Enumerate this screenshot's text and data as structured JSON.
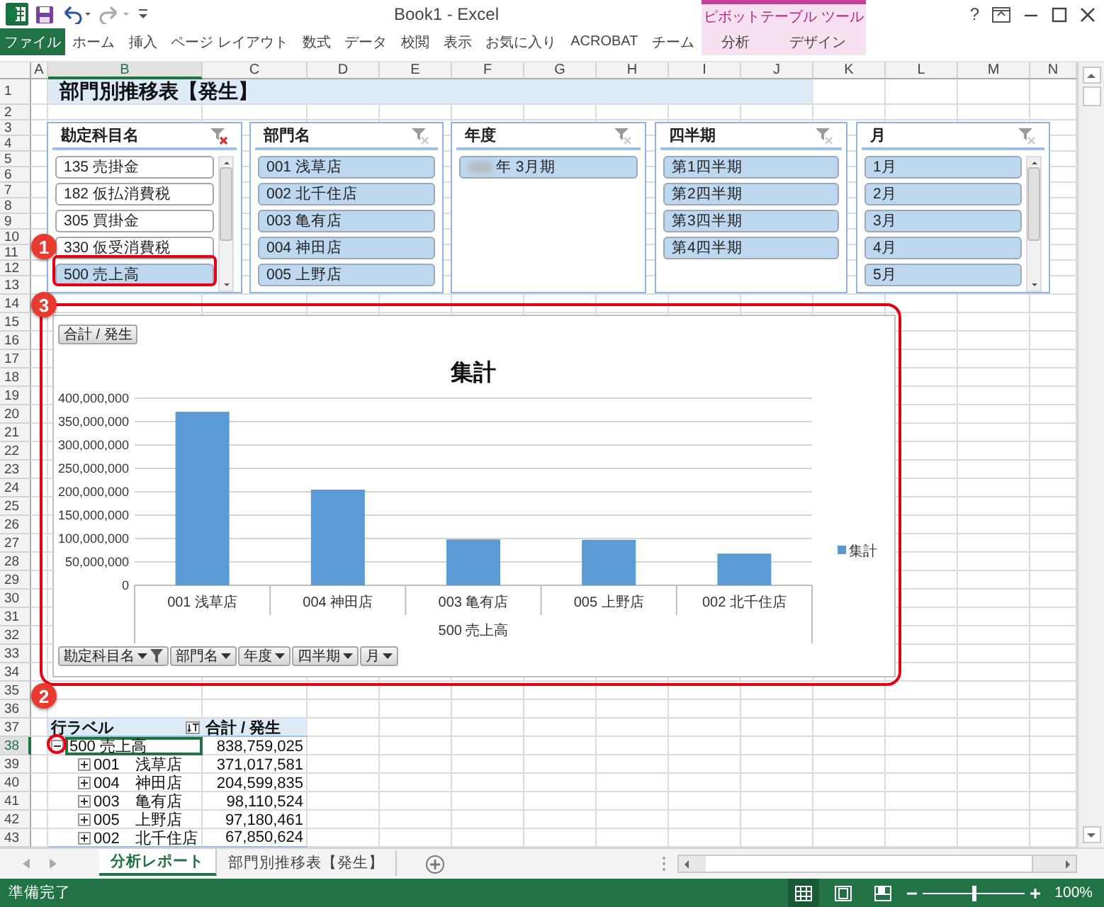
{
  "window": {
    "title": "Book1 - Excel",
    "context_label": "ピボットテーブル ツール",
    "help": "?"
  },
  "ribbon_tabs": [
    {
      "label": "ファイル",
      "kind": "file",
      "selected": false
    },
    {
      "label": "ホーム",
      "kind": "normal",
      "selected": false
    },
    {
      "label": "挿入",
      "kind": "normal",
      "selected": false
    },
    {
      "label": "ページ レイアウト",
      "kind": "normal",
      "selected": false
    },
    {
      "label": "数式",
      "kind": "normal",
      "selected": false
    },
    {
      "label": "データ",
      "kind": "normal",
      "selected": false
    },
    {
      "label": "校閲",
      "kind": "normal",
      "selected": false
    },
    {
      "label": "表示",
      "kind": "normal",
      "selected": false
    },
    {
      "label": "お気に入り",
      "kind": "normal",
      "selected": false
    },
    {
      "label": "ACROBAT",
      "kind": "normal",
      "selected": false
    },
    {
      "label": "チーム",
      "kind": "normal",
      "selected": false
    },
    {
      "label": "分析",
      "kind": "context",
      "selected": false
    },
    {
      "label": "デザイン",
      "kind": "context",
      "selected": false
    }
  ],
  "columns": [
    {
      "label": "A",
      "selected": false
    },
    {
      "label": "B",
      "selected": true
    },
    {
      "label": "C",
      "selected": false
    },
    {
      "label": "D",
      "selected": false
    },
    {
      "label": "E",
      "selected": false
    },
    {
      "label": "F",
      "selected": false
    },
    {
      "label": "G",
      "selected": false
    },
    {
      "label": "H",
      "selected": false
    },
    {
      "label": "I",
      "selected": false
    },
    {
      "label": "J",
      "selected": false
    },
    {
      "label": "K",
      "selected": false
    },
    {
      "label": "L",
      "selected": false
    },
    {
      "label": "M",
      "selected": false
    },
    {
      "label": "N",
      "selected": false
    }
  ],
  "rows": [
    {
      "label": "1",
      "selected": false
    },
    {
      "label": "2",
      "selected": false
    },
    {
      "label": "3",
      "selected": false
    },
    {
      "label": "4",
      "selected": false
    },
    {
      "label": "5",
      "selected": false
    },
    {
      "label": "6",
      "selected": false
    },
    {
      "label": "7",
      "selected": false
    },
    {
      "label": "8",
      "selected": false
    },
    {
      "label": "9",
      "selected": false
    },
    {
      "label": "10",
      "selected": false
    },
    {
      "label": "11",
      "selected": false
    },
    {
      "label": "12",
      "selected": false
    },
    {
      "label": "13",
      "selected": false
    },
    {
      "label": "14",
      "selected": false
    },
    {
      "label": "15",
      "selected": false
    },
    {
      "label": "16",
      "selected": false
    },
    {
      "label": "17",
      "selected": false
    },
    {
      "label": "18",
      "selected": false
    },
    {
      "label": "19",
      "selected": false
    },
    {
      "label": "20",
      "selected": false
    },
    {
      "label": "21",
      "selected": false
    },
    {
      "label": "22",
      "selected": false
    },
    {
      "label": "23",
      "selected": false
    },
    {
      "label": "24",
      "selected": false
    },
    {
      "label": "25",
      "selected": false
    },
    {
      "label": "26",
      "selected": false
    },
    {
      "label": "27",
      "selected": false
    },
    {
      "label": "28",
      "selected": false
    },
    {
      "label": "29",
      "selected": false
    },
    {
      "label": "30",
      "selected": false
    },
    {
      "label": "31",
      "selected": false
    },
    {
      "label": "32",
      "selected": false
    },
    {
      "label": "33",
      "selected": false
    },
    {
      "label": "34",
      "selected": false
    },
    {
      "label": "35",
      "selected": false
    },
    {
      "label": "36",
      "selected": false
    },
    {
      "label": "37",
      "selected": false
    },
    {
      "label": "38",
      "selected": true
    },
    {
      "label": "39",
      "selected": false
    },
    {
      "label": "40",
      "selected": false
    },
    {
      "label": "41",
      "selected": false
    },
    {
      "label": "42",
      "selected": false
    },
    {
      "label": "43",
      "selected": false
    }
  ],
  "sheet_title": "部門別推移表【発生】",
  "slicers": [
    {
      "title": "勘定科目名",
      "filter_active": true,
      "scrollbar": true,
      "items": [
        {
          "label": "135 売掛金",
          "selected": false
        },
        {
          "label": "182 仮払消費税",
          "selected": false
        },
        {
          "label": "305 買掛金",
          "selected": false
        },
        {
          "label": "330 仮受消費税",
          "selected": false
        },
        {
          "label": "500 売上高",
          "selected": true
        }
      ]
    },
    {
      "title": "部門名",
      "filter_active": false,
      "scrollbar": false,
      "items": [
        {
          "label": "001 浅草店",
          "selected": true
        },
        {
          "label": "002 北千住店",
          "selected": true
        },
        {
          "label": "003 亀有店",
          "selected": true
        },
        {
          "label": "004 神田店",
          "selected": true
        },
        {
          "label": "005 上野店",
          "selected": true
        }
      ]
    },
    {
      "title": "年度",
      "filter_active": false,
      "scrollbar": false,
      "items": [
        {
          "label": "年 3月期",
          "selected": true,
          "redacted": true
        }
      ]
    },
    {
      "title": "四半期",
      "filter_active": false,
      "scrollbar": false,
      "items": [
        {
          "label": "第1四半期",
          "selected": true
        },
        {
          "label": "第2四半期",
          "selected": true
        },
        {
          "label": "第3四半期",
          "selected": true
        },
        {
          "label": "第4四半期",
          "selected": true
        }
      ]
    },
    {
      "title": "月",
      "filter_active": false,
      "scrollbar": true,
      "items": [
        {
          "label": "1月",
          "selected": true
        },
        {
          "label": "2月",
          "selected": true
        },
        {
          "label": "3月",
          "selected": true
        },
        {
          "label": "4月",
          "selected": true
        },
        {
          "label": "5月",
          "selected": true
        }
      ]
    }
  ],
  "chart": {
    "filter_button": "合計 / 発生",
    "field_buttons": [
      {
        "label": "勘定科目名",
        "filtered": true
      },
      {
        "label": "部門名",
        "filtered": false
      },
      {
        "label": "年度",
        "filtered": false
      },
      {
        "label": "四半期",
        "filtered": false
      },
      {
        "label": "月",
        "filtered": false
      }
    ],
    "chart_data": {
      "type": "bar",
      "title": "集計",
      "grid": true,
      "xlabel": "500 売上高",
      "categories": [
        "001 浅草店",
        "004 神田店",
        "003 亀有店",
        "005 上野店",
        "002 北千住店"
      ],
      "series": [
        {
          "name": "集計",
          "color": "#5b9bd5",
          "values": [
            371017581,
            204599835,
            98110524,
            97180461,
            67850624
          ]
        }
      ],
      "ylim": [
        0,
        400000000
      ],
      "yticks": [
        {
          "value": 0,
          "label": "0"
        },
        {
          "value": 50000000,
          "label": "50,000,000"
        },
        {
          "value": 100000000,
          "label": "100,000,000"
        },
        {
          "value": 150000000,
          "label": "150,000,000"
        },
        {
          "value": 200000000,
          "label": "200,000,000"
        },
        {
          "value": 250000000,
          "label": "250,000,000"
        },
        {
          "value": 300000000,
          "label": "300,000,000"
        },
        {
          "value": 350000000,
          "label": "350,000,000"
        },
        {
          "value": 400000000,
          "label": "400,000,000"
        }
      ]
    }
  },
  "pivot": {
    "row_header": "行ラベル",
    "value_header": "合計 / 発生",
    "rows": [
      {
        "label": "500 売上高",
        "value": "838,759,025",
        "expanded": true,
        "selected": true,
        "children": [
          {
            "label": "001　浅草店",
            "value": "371,017,581",
            "expanded": false,
            "selected": false
          },
          {
            "label": "004　神田店",
            "value": "204,599,835",
            "expanded": false,
            "selected": false
          },
          {
            "label": "003　亀有店",
            "value": "98,110,524",
            "expanded": false,
            "selected": false
          },
          {
            "label": "005　上野店",
            "value": "97,180,461",
            "expanded": false,
            "selected": false
          },
          {
            "label": "002　北千住店",
            "value": "67,850,624",
            "expanded": false,
            "selected": false
          }
        ]
      }
    ]
  },
  "annotations": [
    {
      "label": "1"
    },
    {
      "label": "3"
    },
    {
      "label": "2"
    }
  ],
  "sheet_tabs": [
    {
      "label": "分析レポート",
      "selected": true
    },
    {
      "label": "部門別推移表【発生】",
      "selected": false
    }
  ],
  "status_bar": {
    "text": "準備完了",
    "views": [
      {
        "kind": "normal",
        "selected": true
      },
      {
        "kind": "page_layout",
        "selected": false
      },
      {
        "kind": "page_break",
        "selected": false
      }
    ],
    "zoom_slider": {
      "level": 0.5
    },
    "zoom": "100%"
  }
}
